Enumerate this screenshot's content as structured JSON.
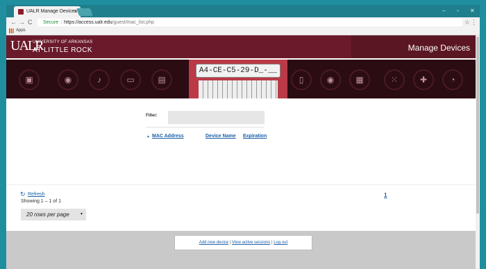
{
  "browser": {
    "tab_title": "UALR Manage Devices",
    "tab_close": "×",
    "secure_label": "Secure",
    "url_domain": "https://access.ualr.edu",
    "url_path": "/guest/mac_list.php",
    "bookmarks_apps": "Apps",
    "win_min": "–",
    "win_max": "▫",
    "win_close": "✕",
    "nav_back": "←",
    "nav_fwd": "→",
    "nav_reload": "C",
    "star": "☆",
    "menu": "⋮"
  },
  "header": {
    "logo_mark": "UALR",
    "logo_line1": "UNIVERSITY OF ARKANSAS",
    "logo_line2": "AT LITTLE ROCK",
    "title": "Manage Devices"
  },
  "banner": {
    "laptop_text": "A4-CE-C5-29-D_-__"
  },
  "filter": {
    "label": "Filter:",
    "value": ""
  },
  "table": {
    "sort_arrow": "▲",
    "columns": [
      "MAC Address",
      "Device Name",
      "Expiration"
    ]
  },
  "pager": {
    "refresh": "Refresh",
    "showing": "Showing 1 – 1 of 1",
    "page": "1",
    "rows_per_page": "20 rows per page",
    "caret": "▼"
  },
  "footer": {
    "add": "Add new device",
    "view": "View active sessions",
    "logout": "Log out",
    "divider": " | "
  },
  "colors": {
    "brand": "#6b1a2b",
    "link": "#1a5fa8"
  }
}
